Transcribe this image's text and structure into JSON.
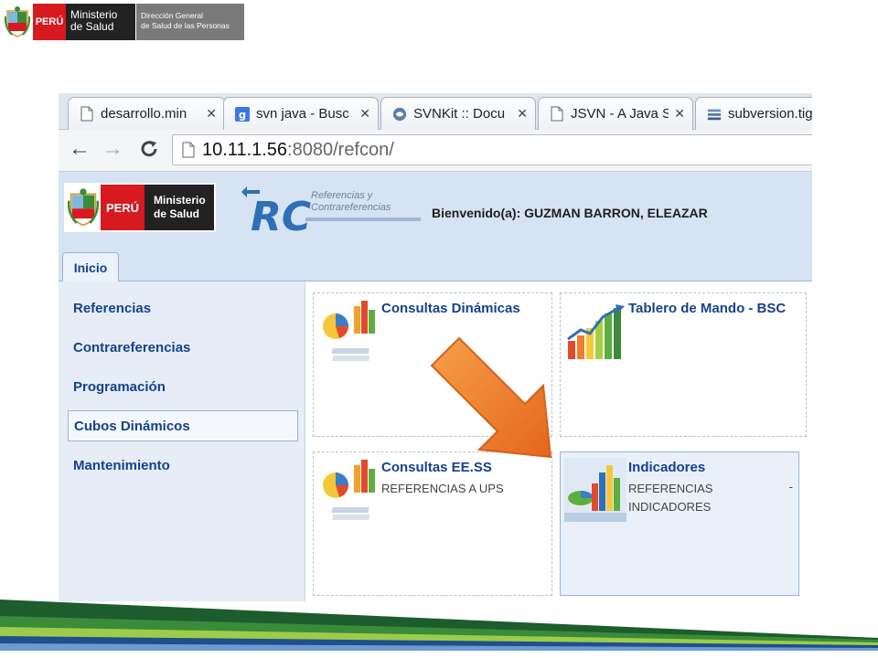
{
  "slide_header": {
    "peru": "PERÚ",
    "ministerio_line1": "Ministerio",
    "ministerio_line2": "de Salud",
    "direccion_line1": "Dirección General",
    "direccion_line2": "de Salud de las Personas"
  },
  "browser": {
    "tabs": [
      {
        "label": "desarrollo.min",
        "icon": "page-icon"
      },
      {
        "label": "svn java - Busc",
        "icon": "google-icon"
      },
      {
        "label": "SVNKit :: Docu",
        "icon": "svnkit-icon"
      },
      {
        "label": "JSVN - A Java S",
        "icon": "page-icon"
      },
      {
        "label": "subversion.tig",
        "icon": "stack-icon"
      }
    ],
    "url_host": "10.11.1.56",
    "url_rest": ":8080/refcon/"
  },
  "app": {
    "logo_peru": "PERÚ",
    "logo_min_line1": "Ministerio",
    "logo_min_line2": "de Salud",
    "rc_line1": "Referencias y",
    "rc_line2": "Contrareferencias",
    "welcome": "Bienvenido(a): GUZMAN BARRON, ELEAZAR",
    "menu_tab": "Inicio",
    "sidebar": [
      {
        "label": "Referencias"
      },
      {
        "label": "Contrareferencias"
      },
      {
        "label": "Programación"
      },
      {
        "label": "Cubos Dinámicos",
        "active": true
      },
      {
        "label": "Mantenimiento"
      }
    ],
    "cards": [
      {
        "title": "Consultas Dinámicas",
        "lines": []
      },
      {
        "title": "Tablero de Mando - BSC",
        "lines": []
      },
      {
        "title": "Consultas EE.SS",
        "lines": [
          "REFERENCIAS A UPS"
        ]
      },
      {
        "title": "Indicadores",
        "lines": [
          "REFERENCIAS",
          "INDICADORES"
        ],
        "trailing": "-",
        "selected": true
      }
    ]
  },
  "colors": {
    "accent_blue": "#15428b",
    "arrow_orange": "#f07d2a",
    "peru_red": "#d71920"
  }
}
